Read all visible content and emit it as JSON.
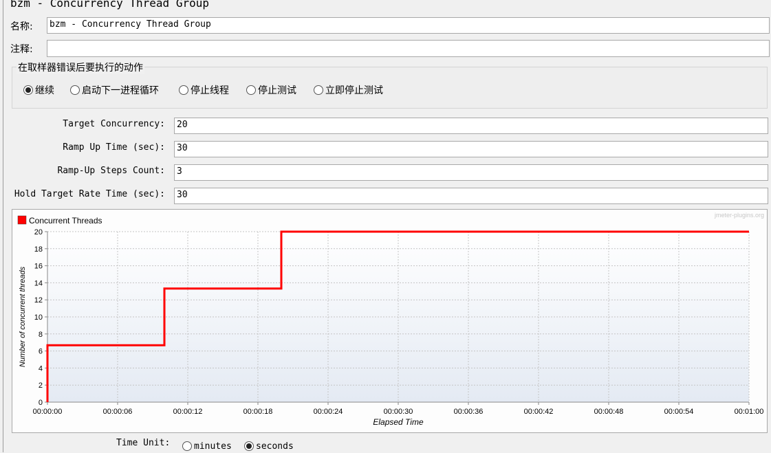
{
  "window": {
    "title": "bzm - Concurrency Thread Group"
  },
  "form": {
    "name_label": "名称:",
    "name_value": "bzm - Concurrency Thread Group",
    "comment_label": "注释:",
    "comment_value": ""
  },
  "sampler_error": {
    "legend": "在取样器错误后要执行的动作",
    "options": [
      {
        "label": "继续",
        "selected": true
      },
      {
        "label": "启动下一进程循环",
        "selected": false
      },
      {
        "label": "停止线程",
        "selected": false
      },
      {
        "label": "停止测试",
        "selected": false
      },
      {
        "label": "立即停止测试",
        "selected": false
      }
    ]
  },
  "params": [
    {
      "label": "Target Concurrency:",
      "value": "20"
    },
    {
      "label": "Ramp Up Time (sec):",
      "value": "30"
    },
    {
      "label": "Ramp-Up Steps Count:",
      "value": "3"
    },
    {
      "label": "Hold Target Rate Time (sec):",
      "value": "30"
    }
  ],
  "chart_data": {
    "type": "line",
    "legend": [
      {
        "name": "Concurrent Threads",
        "color": "#ff0000"
      }
    ],
    "watermark": "jmeter-plugins.org",
    "xlabel": "Elapsed Time",
    "ylabel": "Number of concurrent threads",
    "xlim": [
      0,
      60
    ],
    "ylim": [
      0,
      20
    ],
    "x_ticks": [
      "00:00:00",
      "00:00:06",
      "00:00:12",
      "00:00:18",
      "00:00:24",
      "00:00:30",
      "00:00:36",
      "00:00:42",
      "00:00:48",
      "00:00:54",
      "00:01:00"
    ],
    "y_ticks": [
      "0",
      "2",
      "4",
      "6",
      "8",
      "10",
      "12",
      "14",
      "16",
      "18",
      "20"
    ],
    "grid": true,
    "series": [
      {
        "name": "Concurrent Threads",
        "color": "#ff0000",
        "points": [
          [
            0,
            0
          ],
          [
            0,
            6.67
          ],
          [
            10,
            6.67
          ],
          [
            10,
            13.33
          ],
          [
            20,
            13.33
          ],
          [
            20,
            20
          ],
          [
            60,
            20
          ]
        ]
      }
    ]
  },
  "time_unit": {
    "label": "Time Unit:",
    "options": [
      {
        "label": "minutes",
        "selected": false
      },
      {
        "label": "seconds",
        "selected": true
      }
    ]
  }
}
